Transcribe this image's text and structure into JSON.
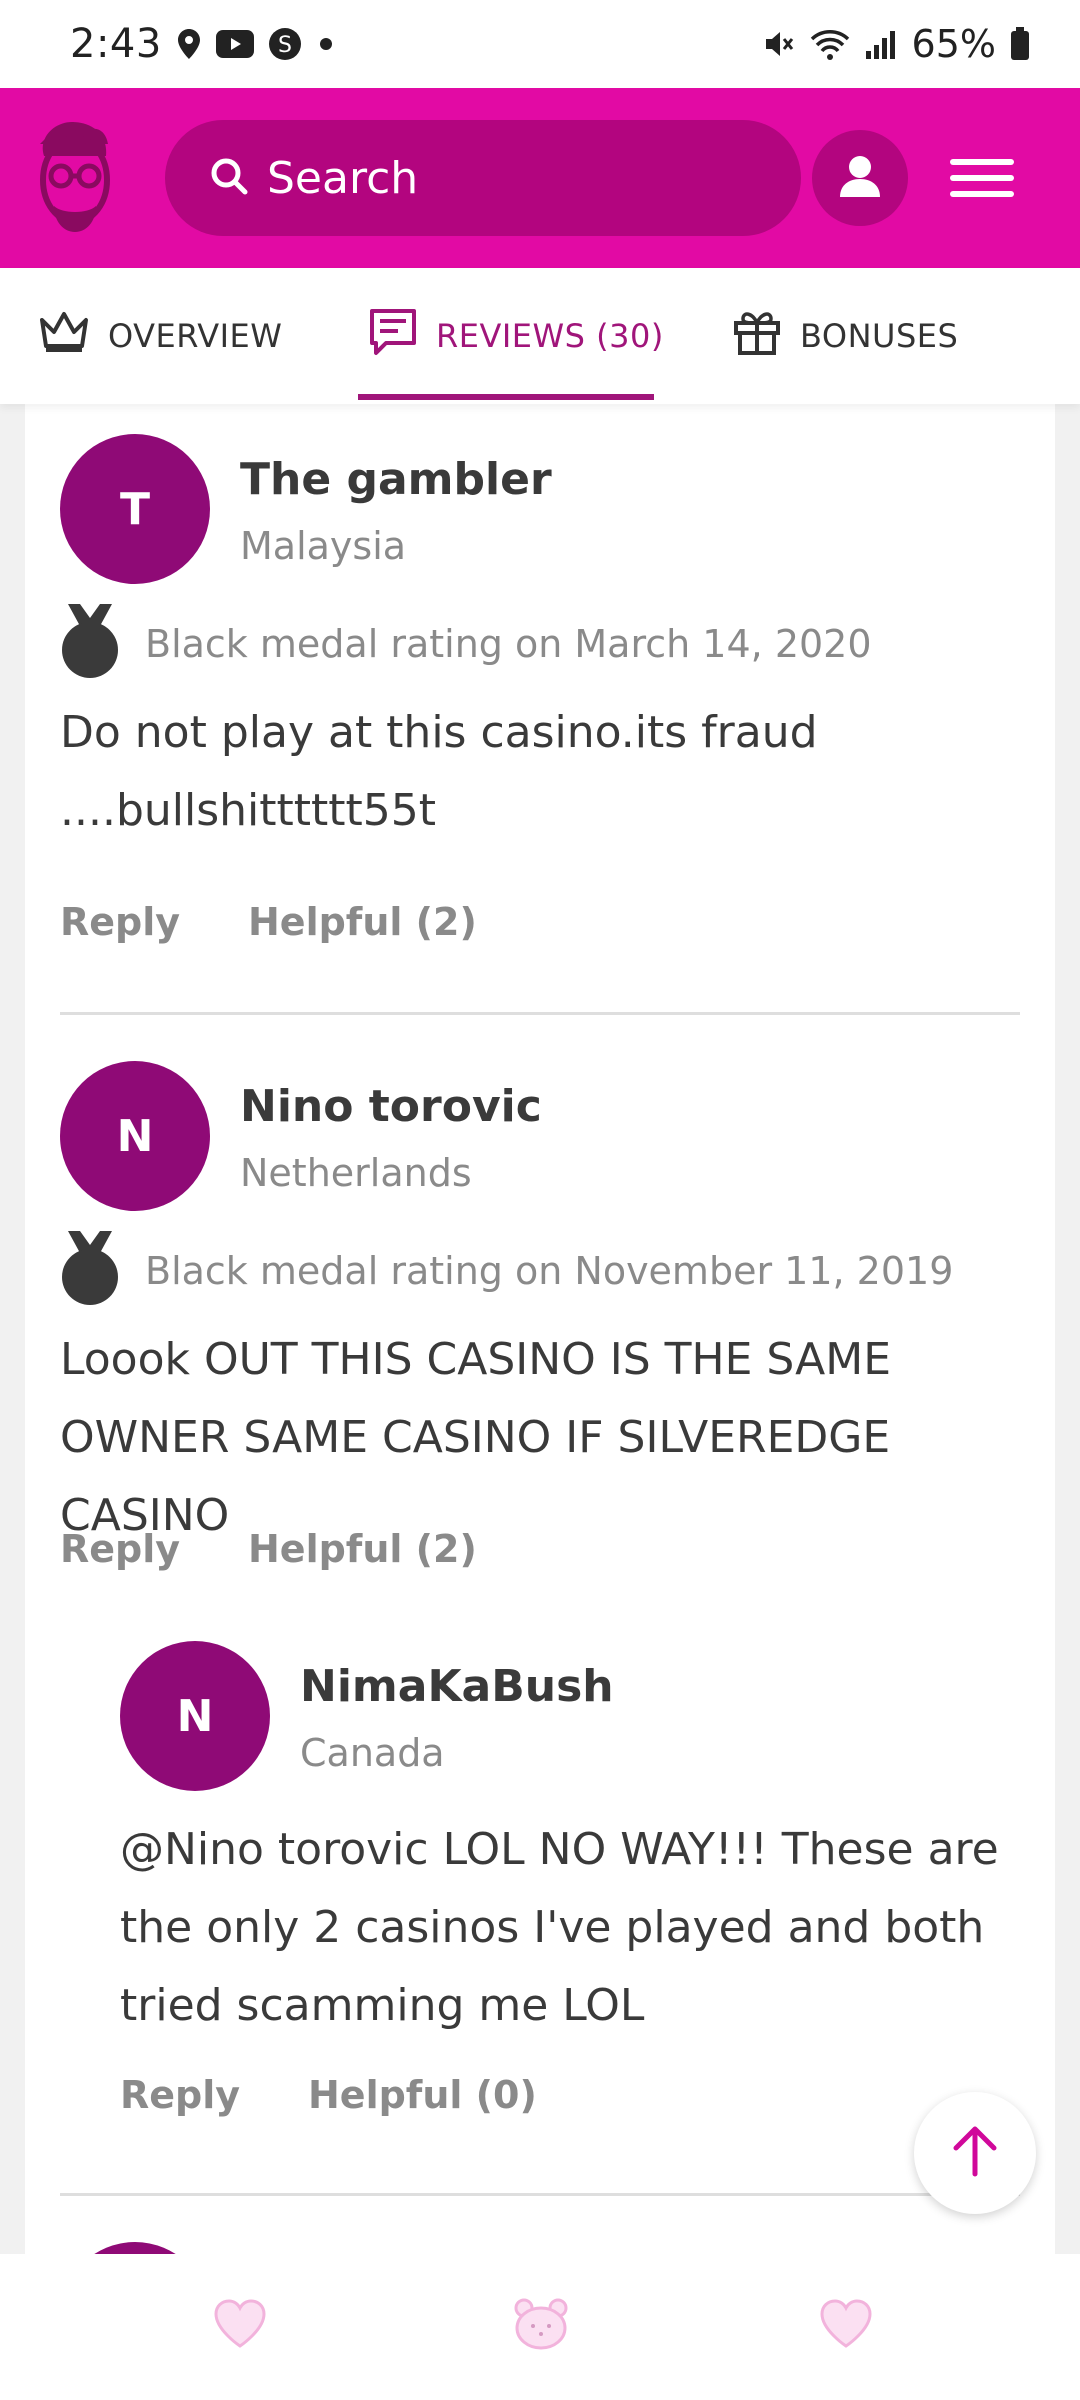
{
  "status_bar": {
    "time": "2:43",
    "battery": "65%",
    "icons": [
      "location-icon",
      "youtube-icon",
      "s-app-icon",
      "dot-icon",
      "mute-icon",
      "wifi-icon",
      "signal-icon",
      "battery-icon"
    ]
  },
  "header": {
    "search_placeholder": "Search",
    "accent_color": "#e20aa4",
    "search_bg": "#b3057f"
  },
  "tabs": [
    {
      "label": "OVERVIEW",
      "icon": "crown-icon",
      "active": false
    },
    {
      "label": "REVIEWS (30)",
      "icon": "chat-icon",
      "active": true
    },
    {
      "label": "BONUSES",
      "icon": "gift-icon",
      "active": false
    }
  ],
  "reviews": [
    {
      "initial": "T",
      "name": "The gambler",
      "country": "Malaysia",
      "rating_text": "Black medal rating on March 14, 2020",
      "body_lines": [
        "Do not play at this casino.its fraud",
        "....bullshitttttt55t"
      ],
      "reply_label": "Reply",
      "helpful_label": "Helpful (2)"
    },
    {
      "initial": "N",
      "name": "Nino torovic",
      "country": "Netherlands",
      "rating_text": "Black medal rating on November 11, 2019",
      "body_lines": [
        "Loook OUT THIS CASINO IS THE SAME",
        "OWNER SAME CASINO IF SILVEREDGE CASINO"
      ],
      "reply_label": "Reply",
      "helpful_label": "Helpful (2)"
    }
  ],
  "reply": {
    "initial": "N",
    "name": "NimaKaBush",
    "country": "Canada",
    "body_lines": [
      "@Nino torovic LOL NO WAY!!! These are",
      "the only 2 casinos I've played and both",
      "tried scamming me LOL"
    ],
    "reply_label": "Reply",
    "helpful_label": "Helpful (0)"
  },
  "avatar_color": "#8f0a76",
  "bottom_bar": {
    "icons": [
      "heart-icon",
      "bear-icon",
      "heart-icon"
    ]
  }
}
